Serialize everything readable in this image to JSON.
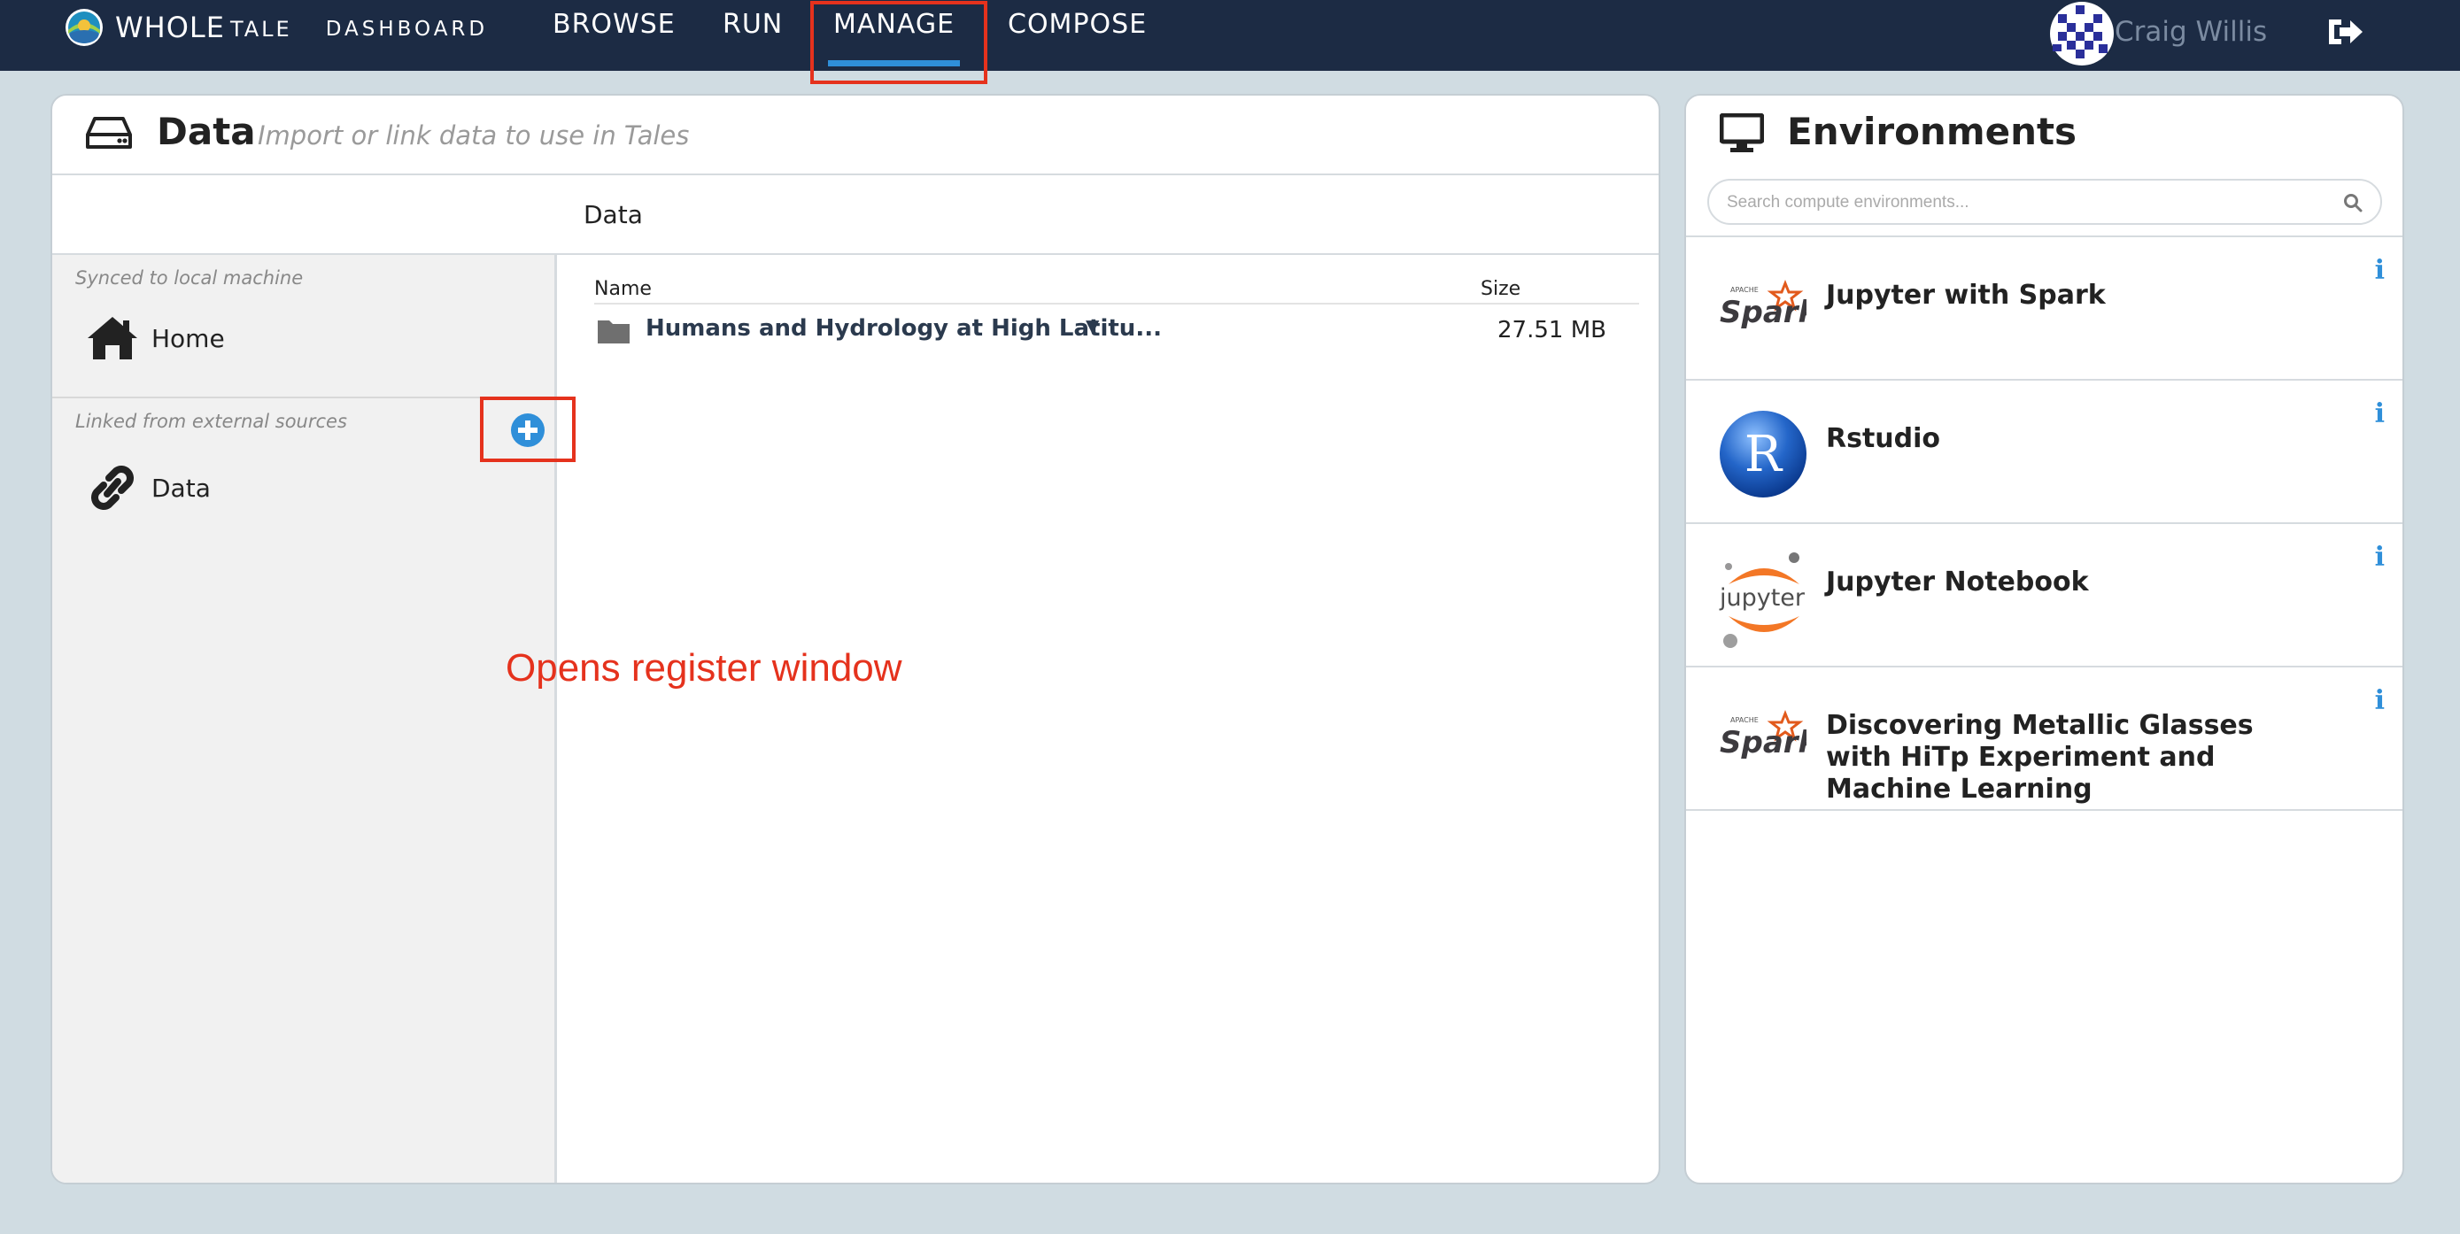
{
  "brand": {
    "whole": "WHOLE",
    "tale": "TALE",
    "dashboard": "DASHBOARD"
  },
  "nav": {
    "browse": "BROWSE",
    "run": "RUN",
    "manage": "MANAGE",
    "compose": "COMPOSE",
    "active": "MANAGE"
  },
  "user": {
    "name": "Craig Willis"
  },
  "data_panel": {
    "title": "Data",
    "subtitle": "Import or link data to use in Tales",
    "subheader": "Data",
    "sidebar": {
      "synced_label": "Synced to local machine",
      "home_label": "Home",
      "linked_label": "Linked from external sources",
      "data_label": "Data"
    },
    "annotation": "Opens register window",
    "columns": {
      "name": "Name",
      "size": "Size"
    },
    "files": [
      {
        "name": "Humans and Hydrology at High Latitu...",
        "size": "27.51 MB",
        "icon": "folder-icon"
      }
    ]
  },
  "env_panel": {
    "title": "Environments",
    "search_placeholder": "Search compute environments...",
    "items": [
      {
        "name": "Jupyter with Spark",
        "logo": "spark-logo"
      },
      {
        "name": "Rstudio",
        "logo": "r-logo"
      },
      {
        "name": "Jupyter Notebook",
        "logo": "jupyter-logo"
      },
      {
        "name": "Discovering Metallic Glasses with HiTp Experiment and Machine Learning",
        "logo": "spark-logo"
      }
    ]
  },
  "colors": {
    "nav_bg": "#1c2b44",
    "accent_blue": "#2f8fd9",
    "annotation_red": "#e5321d",
    "page_bg": "#d0dce2"
  }
}
